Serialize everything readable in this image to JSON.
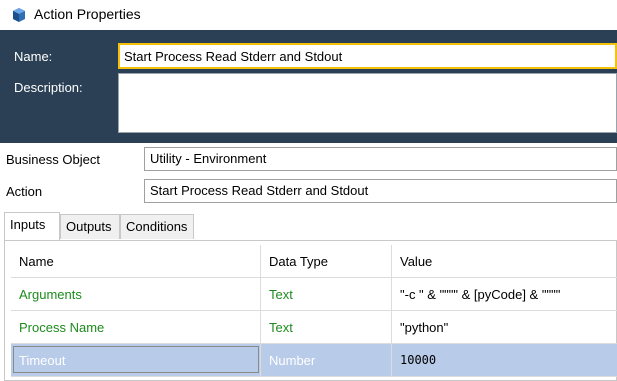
{
  "window": {
    "title": "Action Properties"
  },
  "header": {
    "name_label": "Name:",
    "name_value": "Start Process Read Stderr and Stdout",
    "description_label": "Description:",
    "description_value": ""
  },
  "fields": {
    "business_object_label": "Business Object",
    "business_object_value": "Utility - Environment",
    "action_label": "Action",
    "action_value": "Start Process Read Stderr and Stdout"
  },
  "tabs": [
    {
      "label": "Inputs",
      "active": true
    },
    {
      "label": "Outputs",
      "active": false
    },
    {
      "label": "Conditions",
      "active": false
    }
  ],
  "grid": {
    "columns": [
      "Name",
      "Data Type",
      "Value"
    ],
    "rows": [
      {
        "name": "Arguments",
        "type": "Text",
        "value": "\"-c \" & \"\"\"\" & [pyCode] & \"\"\"\""
      },
      {
        "name": "Process Name",
        "type": "Text",
        "value": "\"python\""
      },
      {
        "name": "Timeout",
        "type": "Number",
        "value": "10000"
      }
    ]
  },
  "colors": {
    "header_bg": "#2b3f55",
    "name_border": "#f4c20d",
    "param_green": "#1e8a1e",
    "selection": "#b8cbe9"
  }
}
